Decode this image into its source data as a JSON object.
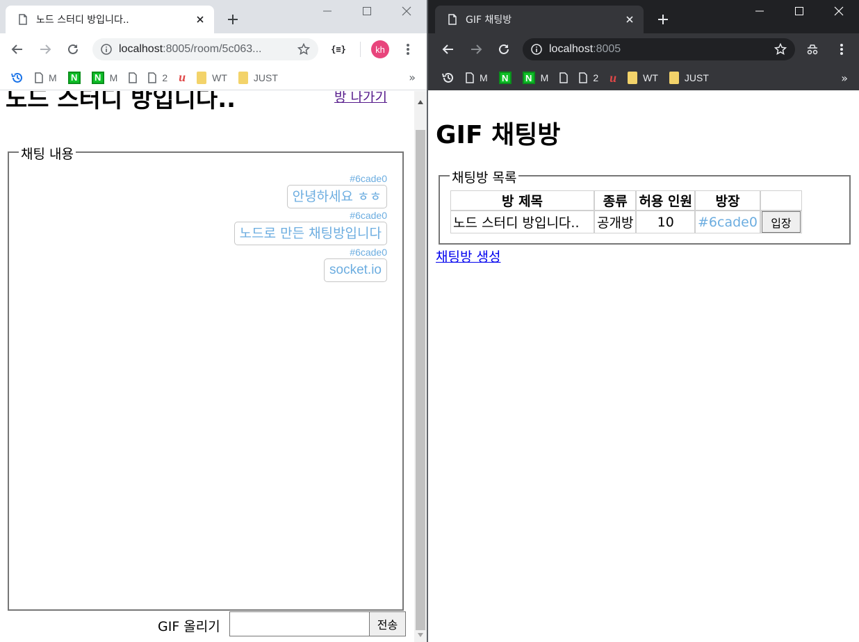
{
  "left_browser": {
    "tab_title": "노드 스터디 방입니다..",
    "url_host": "localhost",
    "url_rest": ":8005/room/5c063...",
    "profile_initials": "kh",
    "bookmarks": [
      "M",
      "M",
      "2",
      "WT",
      "JUST"
    ],
    "more_bookmarks": "»"
  },
  "right_browser": {
    "tab_title": "GIF 채팅방",
    "url_host": "localhost",
    "url_rest": ":8005",
    "bookmarks": [
      "M",
      "M",
      "2",
      "WT",
      "JUST"
    ],
    "more_bookmarks": "»"
  },
  "room_page": {
    "title": "노드 스터디 방입니다..",
    "exit_link": "방 나가기",
    "chat_legend": "채팅 내용",
    "messages": [
      {
        "user": "#6cade0",
        "text": "안녕하세요 ㅎㅎ"
      },
      {
        "user": "#6cade0",
        "text": "노드로 만든 채팅방입니다"
      },
      {
        "user": "#6cade0",
        "text": "socket.io"
      }
    ],
    "gif_label": "GIF 올리기",
    "send_button": "전송"
  },
  "main_page": {
    "title": "GIF 채팅방",
    "list_legend": "채팅방 목록",
    "table_headers": [
      "방 제목",
      "종류",
      "허용 인원",
      "방장"
    ],
    "rooms": [
      {
        "title": "노드 스터디 방입니다..",
        "type": "공개방",
        "max": "10",
        "owner": "#6cade0",
        "enter": "입장"
      }
    ],
    "create_link": "채팅방 생성"
  },
  "colors": {
    "user_color": "#6cade0",
    "visited_link": "#551a8b",
    "link": "#0000ee",
    "dark_frame": "#202124",
    "dark_toolbar": "#35363a",
    "light_frame": "#dee1e6",
    "profile_avatar": "#e8457c"
  },
  "icons": [
    "page-icon",
    "close-icon",
    "plus-icon",
    "minimize-icon",
    "maximize-icon",
    "back-icon",
    "forward-icon",
    "reload-icon",
    "info-icon",
    "star-icon",
    "extension-icon",
    "incognito-icon",
    "menu-icon",
    "history-icon",
    "naver-icon",
    "folder-icon"
  ]
}
